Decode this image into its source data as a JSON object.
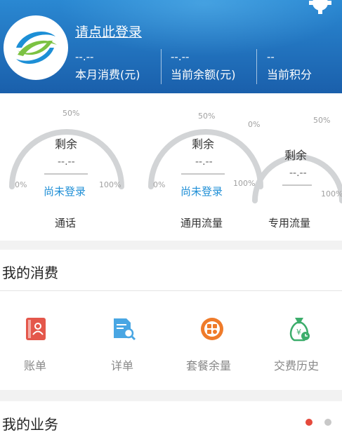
{
  "header": {
    "login_link": "请点此登录",
    "stats": [
      {
        "value": "--.--",
        "label": "本月消费(元)"
      },
      {
        "value": "--.--",
        "label": "当前余额(元)"
      },
      {
        "value": "--",
        "label": "当前积分"
      }
    ]
  },
  "gauges": [
    {
      "name": "通话",
      "remaining_label": "剩余",
      "value": "--.--",
      "status": "尚未登录",
      "min": "0%",
      "mid": "50%",
      "max": "100%"
    },
    {
      "name": "通用流量",
      "remaining_label": "剩余",
      "value": "--.--",
      "status": "尚未登录",
      "min": "0%",
      "mid": "50%",
      "max": "100%"
    },
    {
      "name": "专用流量",
      "remaining_label": "剩余",
      "value": "--.--",
      "min": "0%",
      "mid": "50%",
      "max": "100%"
    }
  ],
  "consumption": {
    "title": "我的消费",
    "items": [
      {
        "label": "账单",
        "icon": "bill-icon",
        "color": "#e4574b"
      },
      {
        "label": "详单",
        "icon": "detail-search-icon",
        "color": "#49a6e3"
      },
      {
        "label": "套餐余量",
        "icon": "package-icon",
        "color": "#ef7b2a"
      },
      {
        "label": "交费历史",
        "icon": "money-bag-icon",
        "color": "#3cad6b"
      }
    ]
  },
  "business": {
    "title": "我的业务",
    "page_dots_active_color": "#e54a3c",
    "page_dots_inactive_color": "#c8c8c8"
  }
}
